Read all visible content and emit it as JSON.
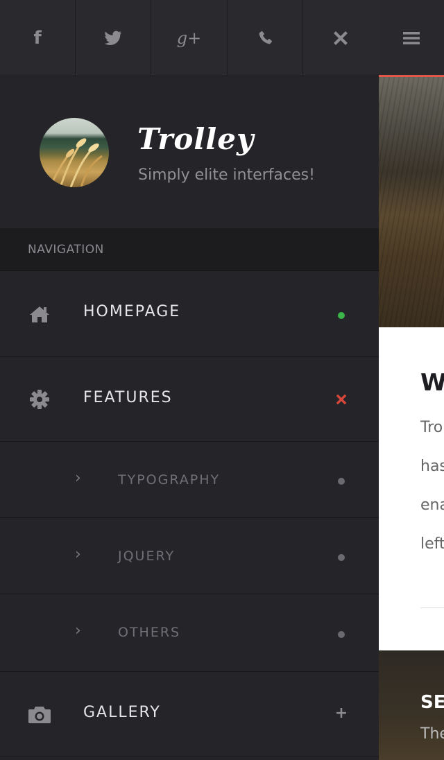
{
  "social": {
    "buttons": [
      {
        "icon": "facebook-icon"
      },
      {
        "icon": "twitter-icon"
      },
      {
        "icon": "google-plus-icon"
      },
      {
        "icon": "phone-icon"
      },
      {
        "icon": "close-icon"
      }
    ],
    "glyphs": {
      "facebook": "f",
      "google_plus": "g+"
    }
  },
  "profile": {
    "brand": "Trolley",
    "tagline": "Simply elite interfaces!"
  },
  "navigation": {
    "heading": "NAVIGATION",
    "items": [
      {
        "label": "HOMEPAGE",
        "icon": "home-icon",
        "status": "green-dot"
      },
      {
        "label": "FEATURES",
        "icon": "gear-icon",
        "status": "red-x"
      },
      {
        "label": "TYPOGRAPHY",
        "icon": "chevron-right-icon",
        "status": "gray-dot",
        "sub": true
      },
      {
        "label": "JQUERY",
        "icon": "chevron-right-icon",
        "status": "gray-dot",
        "sub": true
      },
      {
        "label": "OTHERS",
        "icon": "chevron-right-icon",
        "status": "gray-dot",
        "sub": true
      },
      {
        "label": "GALLERY",
        "icon": "camera-icon",
        "status": "plus"
      }
    ],
    "chevron": "›",
    "plus": "+"
  },
  "content": {
    "menu_icon": "hamburger-icon",
    "article": {
      "title": "W",
      "lines": [
        "Tro",
        "has",
        "ena",
        "left"
      ]
    },
    "footer": {
      "title": "SE",
      "text": "The"
    }
  },
  "colors": {
    "sidebar_bg": "#252529",
    "accent_red": "#e0574a",
    "status_green": "#3bb54a",
    "status_red": "#d9463a",
    "status_gray": "#6a6a70"
  }
}
